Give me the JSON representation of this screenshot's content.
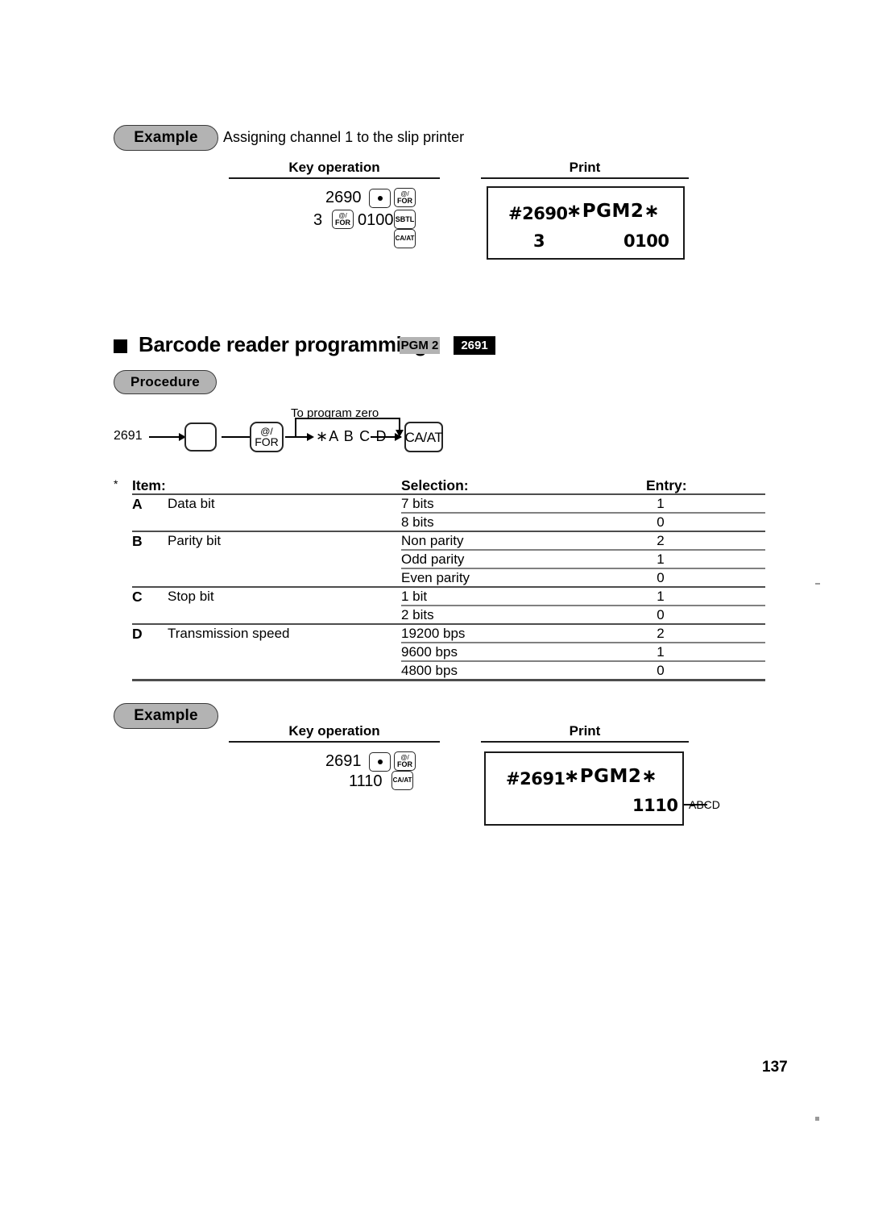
{
  "page": {
    "number": "137"
  },
  "example1": {
    "badge_label": "Example",
    "caption": "Assigning channel 1 to the slip printer",
    "key_operation_header": "Key operation",
    "print_header": "Print",
    "keys": {
      "row1_number": "2690",
      "row1_dot": "•",
      "row1_for_top": "@/",
      "row1_for_bottom": "FOR",
      "row2_number": "3",
      "row2_for_top": "@/",
      "row2_for_bottom": "FOR",
      "row2_value": "0100",
      "row2_sbtl": "SBTL",
      "row3_caat": "CA/AT"
    },
    "print": {
      "id": "#2690",
      "mode": "∗PGM2∗",
      "left_value": "3",
      "right_value": "0100"
    }
  },
  "section": {
    "title": "Barcode reader programming",
    "badge_mode": "PGM 2",
    "badge_code": "2691",
    "procedure_label": "Procedure"
  },
  "procedure": {
    "start_code": "2691",
    "key_dot": "•",
    "key_for_top": "@/",
    "key_for_bottom": "FOR",
    "note": "To program zero",
    "entry_pattern": "∗A B C D",
    "key_caat": "CA/AT"
  },
  "table": {
    "asterisk": "*",
    "headers": {
      "item": "Item:",
      "selection": "Selection:",
      "entry": "Entry:"
    },
    "groups": [
      {
        "letter": "A",
        "item": "Data bit",
        "rows": [
          {
            "selection": "7 bits",
            "entry": "1"
          },
          {
            "selection": "8 bits",
            "entry": "0"
          }
        ]
      },
      {
        "letter": "B",
        "item": "Parity bit",
        "rows": [
          {
            "selection": "Non parity",
            "entry": "2"
          },
          {
            "selection": "Odd parity",
            "entry": "1"
          },
          {
            "selection": "Even parity",
            "entry": "0"
          }
        ]
      },
      {
        "letter": "C",
        "item": "Stop bit",
        "rows": [
          {
            "selection": "1 bit",
            "entry": "1"
          },
          {
            "selection": "2 bits",
            "entry": "0"
          }
        ]
      },
      {
        "letter": "D",
        "item": "Transmission speed",
        "rows": [
          {
            "selection": "19200 bps",
            "entry": "2"
          },
          {
            "selection": "9600 bps",
            "entry": "1"
          },
          {
            "selection": "4800 bps",
            "entry": "0"
          }
        ]
      }
    ]
  },
  "example2": {
    "badge_label": "Example",
    "key_operation_header": "Key operation",
    "print_header": "Print",
    "keys": {
      "row1_number": "2691",
      "row1_dot": "•",
      "row1_for_top": "@/",
      "row1_for_bottom": "FOR",
      "row2_number": "1110",
      "row2_caat": "CA/AT"
    },
    "print": {
      "id": "#2691",
      "mode": "∗PGM2∗",
      "value": "1110",
      "callout": "ABCD"
    }
  }
}
